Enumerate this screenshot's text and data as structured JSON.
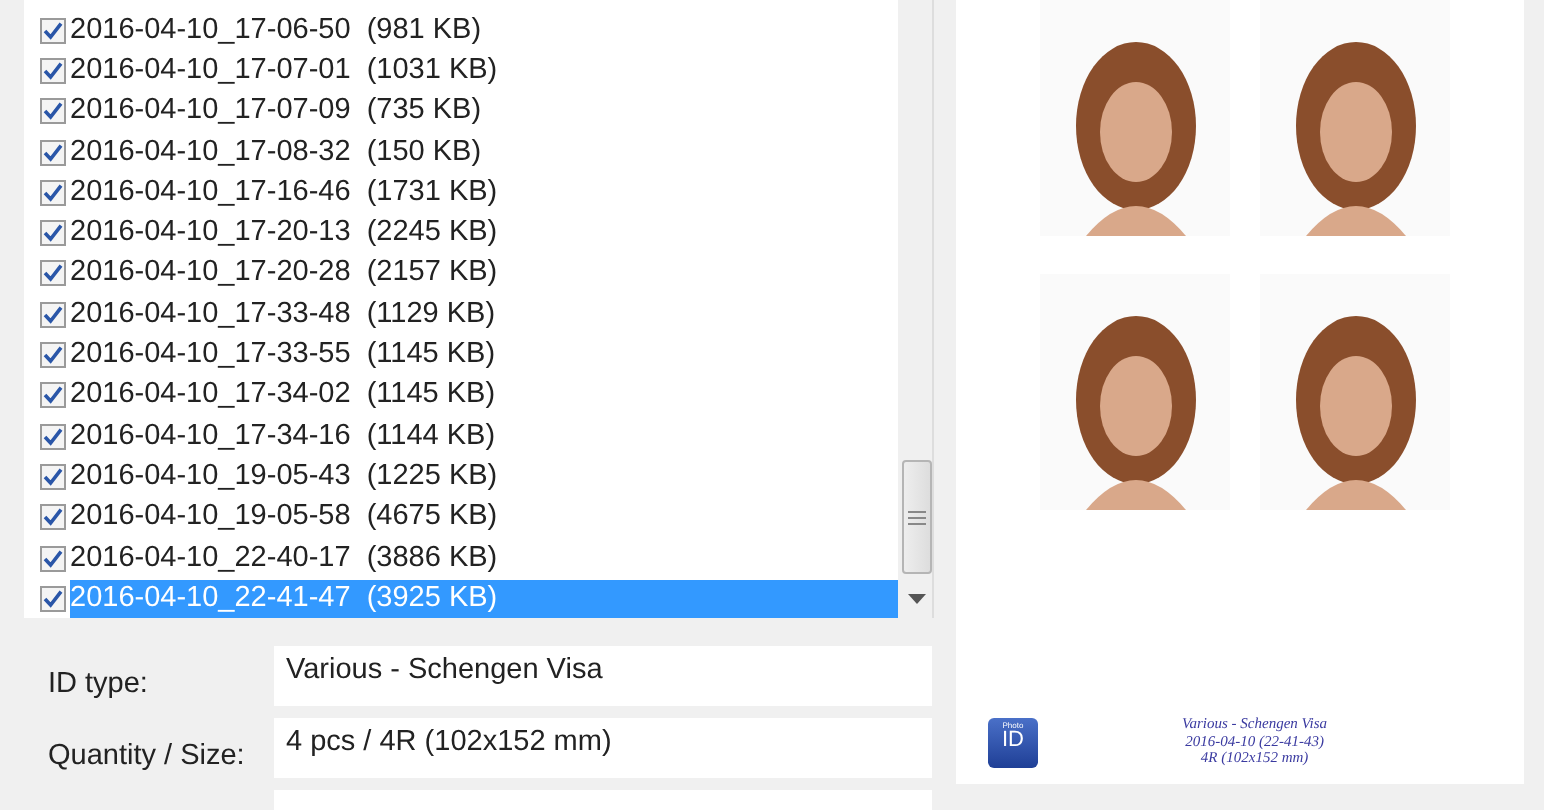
{
  "file_list": {
    "items": [
      {
        "name": "2016-04-10_17-06-50",
        "size": "(981 KB)",
        "checked": true,
        "selected": false
      },
      {
        "name": "2016-04-10_17-07-01",
        "size": "(1031 KB)",
        "checked": true,
        "selected": false
      },
      {
        "name": "2016-04-10_17-07-09",
        "size": "(735 KB)",
        "checked": true,
        "selected": false
      },
      {
        "name": "2016-04-10_17-08-32",
        "size": "(150 KB)",
        "checked": true,
        "selected": false
      },
      {
        "name": "2016-04-10_17-16-46",
        "size": "(1731 KB)",
        "checked": true,
        "selected": false
      },
      {
        "name": "2016-04-10_17-20-13",
        "size": "(2245 KB)",
        "checked": true,
        "selected": false
      },
      {
        "name": "2016-04-10_17-20-28",
        "size": "(2157 KB)",
        "checked": true,
        "selected": false
      },
      {
        "name": "2016-04-10_17-33-48",
        "size": "(1129 KB)",
        "checked": true,
        "selected": false
      },
      {
        "name": "2016-04-10_17-33-55",
        "size": "(1145 KB)",
        "checked": true,
        "selected": false
      },
      {
        "name": "2016-04-10_17-34-02",
        "size": "(1145 KB)",
        "checked": true,
        "selected": false
      },
      {
        "name": "2016-04-10_17-34-16",
        "size": "(1144 KB)",
        "checked": true,
        "selected": false
      },
      {
        "name": "2016-04-10_19-05-43",
        "size": "(1225 KB)",
        "checked": true,
        "selected": false
      },
      {
        "name": "2016-04-10_19-05-58",
        "size": "(4675 KB)",
        "checked": true,
        "selected": false
      },
      {
        "name": "2016-04-10_22-40-17",
        "size": "(3886 KB)",
        "checked": true,
        "selected": false
      },
      {
        "name": "2016-04-10_22-41-47",
        "size": "(3925 KB)",
        "checked": true,
        "selected": true
      }
    ]
  },
  "details": [
    {
      "label": "ID type:",
      "value": "Various - Schengen Visa"
    },
    {
      "label": "Quantity / Size:",
      "value": "4 pcs / 4R (102x152 mm)"
    }
  ],
  "preview": {
    "logo": {
      "top": "Photo",
      "main": "ID"
    },
    "caption": [
      "Various - Schengen Visa",
      "2016-04-10 (22-41-43)",
      "4R (102x152 mm)"
    ]
  }
}
